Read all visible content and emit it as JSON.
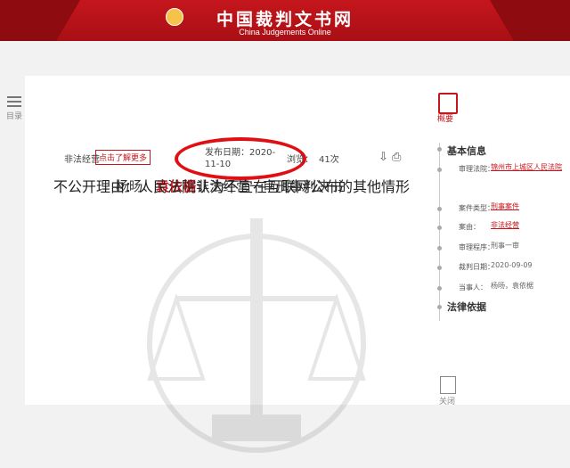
{
  "site": {
    "title": "中国裁判文书网",
    "subtitle": "China Judgements Online"
  },
  "left_tool": {
    "label": "目录"
  },
  "document": {
    "title_prefix": "杨旸、",
    "title_highlight": "袁依椐",
    "title_suffix": "非法经营一审刑事判决书",
    "case_cause": "非法经营",
    "tag": "点击了解更多",
    "publish_label": "发布日期：",
    "publish_date": "2020-11-10",
    "views_label": "浏览：",
    "views_count": "41次",
    "reason": "不公开理由：人民法院认为不宜在互联网公布的其他情形"
  },
  "panel": {
    "overview_label": "概要",
    "basic_info": "基本信息",
    "fields": [
      {
        "k": "审理法院：",
        "v": "锦州市上城区人民法院"
      },
      {
        "k": "案件类型：",
        "v": "刑事案件"
      },
      {
        "k": "案由：",
        "v": "非法经营"
      },
      {
        "k": "审理程序：",
        "v": "刑事一审"
      },
      {
        "k": "裁判日期：",
        "v": "2020-09-09"
      },
      {
        "k": "当事人：",
        "v": "杨旸，袁依椐"
      }
    ],
    "legal_basis": "法律依据",
    "close_label": "关闭"
  },
  "colors": {
    "brand_red": "#c4161c",
    "annotation_red": "#e10f14"
  }
}
